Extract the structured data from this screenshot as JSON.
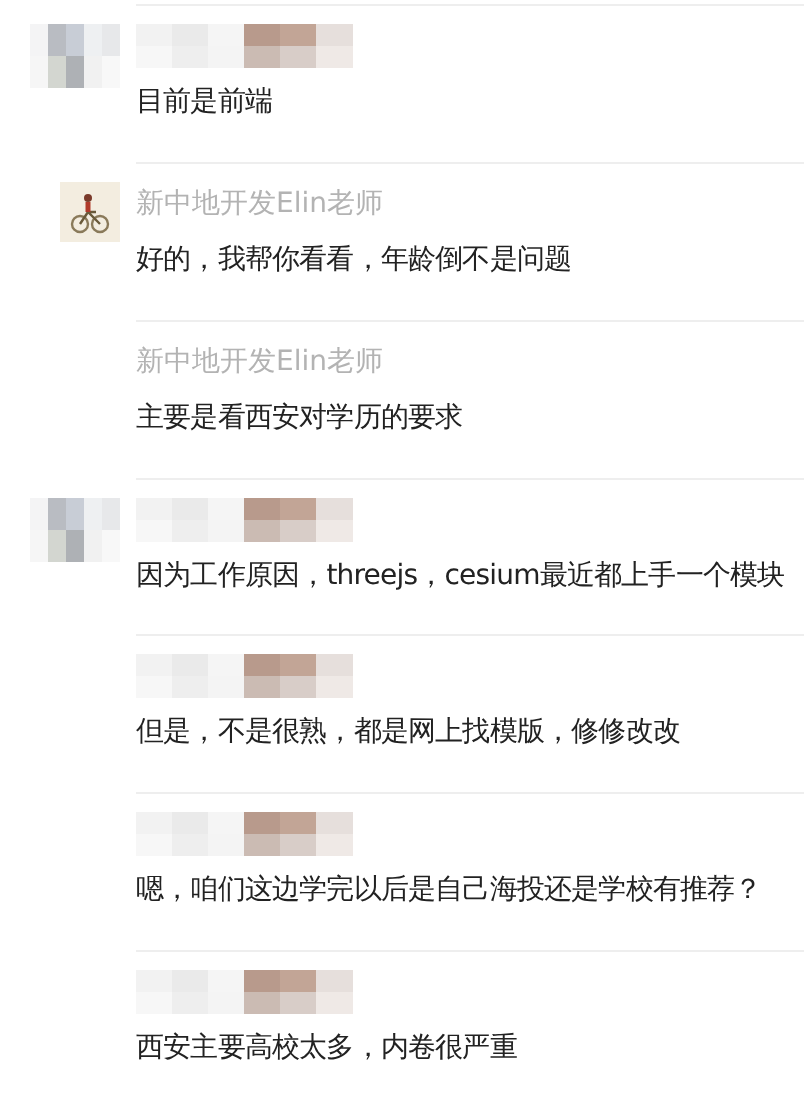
{
  "messages": [
    {
      "sender": {
        "kind": "redacted"
      },
      "text": "目前是前端"
    },
    {
      "avatar": {
        "kind": "icon"
      },
      "sender": {
        "kind": "name",
        "text": "新中地开发Elin老师"
      },
      "text": "好的，我帮你看看，年龄倒不是问题"
    },
    {
      "sender": {
        "kind": "name",
        "text": "新中地开发Elin老师"
      },
      "text": "主要是看西安对学历的要求"
    },
    {
      "sender": {
        "kind": "redacted"
      },
      "text": "因为工作原因，threejs，cesium最近都上手一个模块"
    },
    {
      "sender": {
        "kind": "redacted"
      },
      "text": "但是，不是很熟，都是网上找模版，修修改改"
    },
    {
      "sender": {
        "kind": "redacted"
      },
      "text": "嗯，咱们这边学完以后是自己海投还是学校有推荐？"
    },
    {
      "sender": {
        "kind": "redacted"
      },
      "text": "西安主要高校太多，内卷很严重"
    }
  ]
}
